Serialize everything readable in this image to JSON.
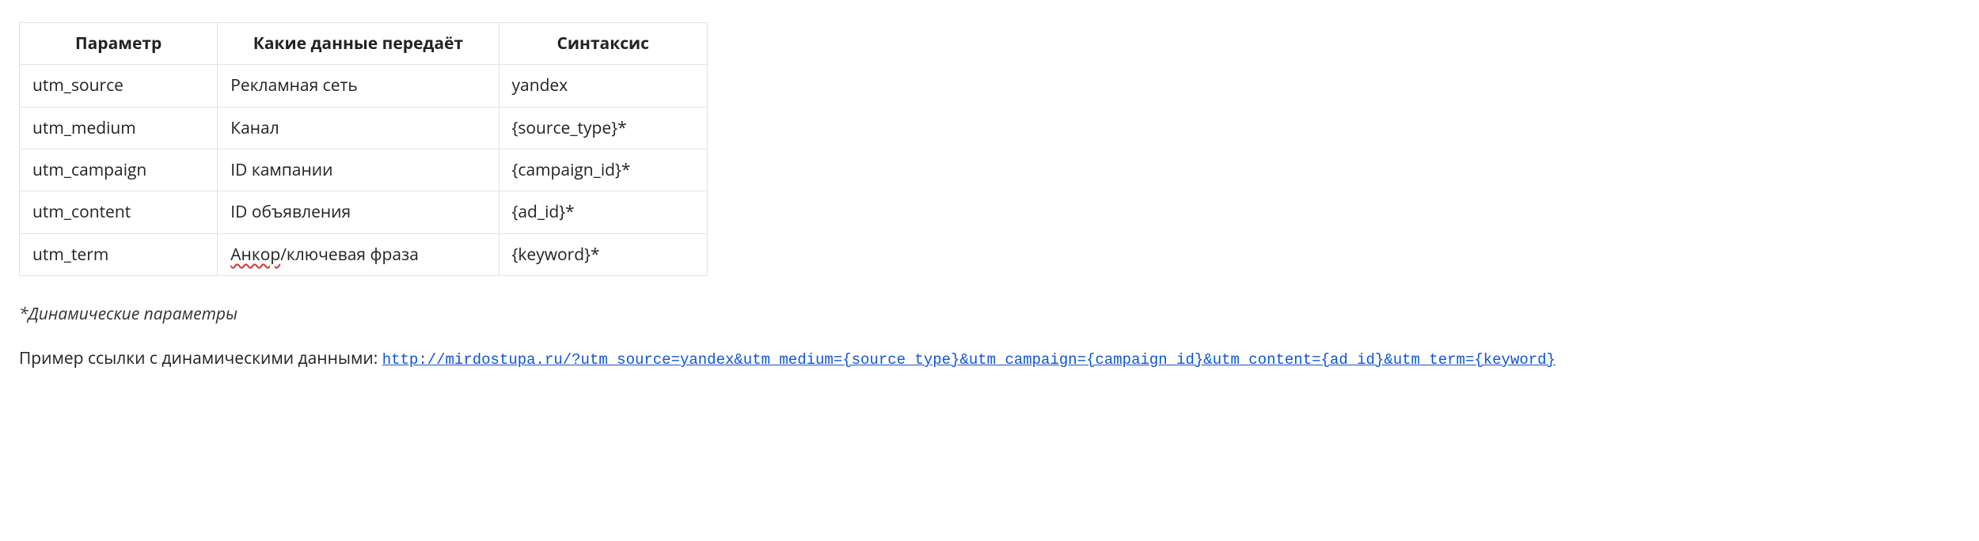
{
  "table": {
    "headers": {
      "param": "Параметр",
      "data": "Какие данные передаёт",
      "syntax": "Синтаксис"
    },
    "rows": [
      {
        "param": "utm_source",
        "data": "Рекламная сеть",
        "syntax": "yandex"
      },
      {
        "param": "utm_medium",
        "data": "Канал",
        "syntax": "{source_type}*"
      },
      {
        "param": "utm_campaign",
        "data": "ID кампании",
        "syntax": "{campaign_id}*"
      },
      {
        "param": "utm_content",
        "data": "ID объявления",
        "syntax": "{ad_id}*"
      },
      {
        "param": "utm_term",
        "data_prefix": "Анкор",
        "data_suffix": "/ключевая фраза",
        "syntax": "{keyword}*"
      }
    ]
  },
  "note": "*Динамические параметры",
  "example": {
    "prefix": "Пример ссылки с динамическими данными: ",
    "url": "http://mirdostupa.ru/?utm_source=yandex&utm_medium={source_type}&utm_campaign={campaign_id}&utm_content={ad_id}&utm_term={keyword}"
  }
}
